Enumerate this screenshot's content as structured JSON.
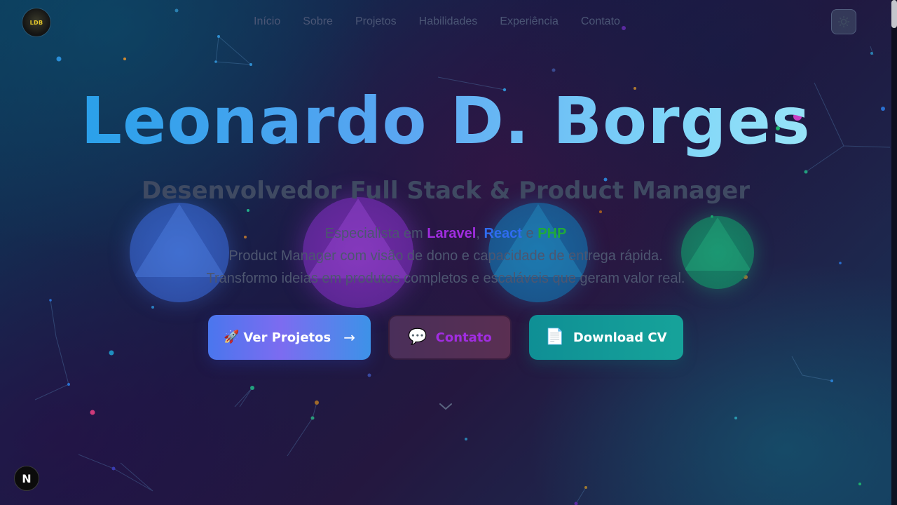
{
  "header": {
    "logo_text": "LDB",
    "nav": [
      "Início",
      "Sobre",
      "Projetos",
      "Habilidades",
      "Experiência",
      "Contato"
    ],
    "theme_toggle_icon": "sun-icon"
  },
  "hero": {
    "title": "Leonardo D. Borges",
    "subtitle": "Desenvolvedor Full Stack & Product Manager",
    "tagline": {
      "prefix": "Especialista em ",
      "tech1": "Laravel",
      "sep1": ", ",
      "tech2": "React",
      "sep2": " e ",
      "tech3": "PHP"
    },
    "description_line1": "Product Manager com visão de dono e capacidade de entrega rápida.",
    "description_line2": "Transformo ideias em produtos completos e escaláveis que geram valor real."
  },
  "buttons": {
    "projects": {
      "icon": "🚀",
      "label": "Ver Projetos",
      "arrow": "→"
    },
    "contact": {
      "icon": "💬",
      "label": "Contato"
    },
    "cv": {
      "icon": "📄",
      "label": "Download CV"
    }
  },
  "colors": {
    "laravel": "#a12de0",
    "react": "#2f6cf0",
    "php": "#1faa3a",
    "title_gradient": [
      "#1e9fe8",
      "#7fd5f8"
    ]
  },
  "icons": {
    "scroll_down": "chevron-down-icon",
    "dev_badge": "nextjs-icon"
  },
  "dev_badge_text": "N"
}
